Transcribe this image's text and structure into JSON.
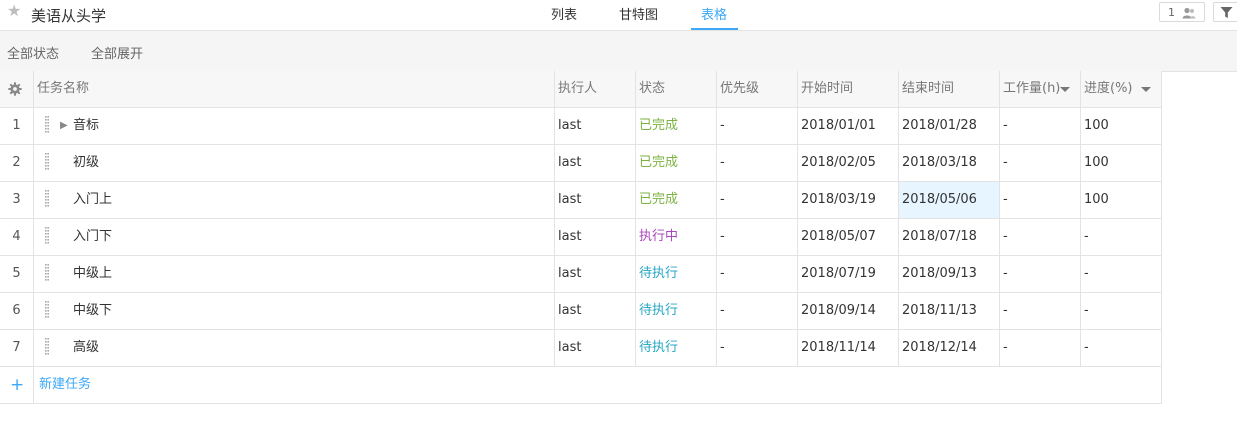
{
  "project": {
    "title": "美语从头学",
    "star_icon": "star-icon"
  },
  "tabs": [
    {
      "label": "列表",
      "active": false
    },
    {
      "label": "甘特图",
      "active": false
    },
    {
      "label": "表格",
      "active": true
    }
  ],
  "header_actions": {
    "member_count": "1",
    "member_icon": "person-icon",
    "filter_icon": "filter-icon"
  },
  "toolbar": {
    "status_all": "全部状态",
    "expand_all": "全部展开"
  },
  "columns": {
    "settings_icon": "gear-icon",
    "name": "任务名称",
    "executor": "执行人",
    "status": "状态",
    "priority": "优先级",
    "start": "开始时间",
    "end": "结束时间",
    "workload": "工作量(h)",
    "progress": "进度(%)"
  },
  "status_colors": {
    "已完成": "#7cb342",
    "执行中": "#ab47bc",
    "待执行": "#26a6c4"
  },
  "rows": [
    {
      "idx": "1",
      "name": "音标",
      "has_children": true,
      "executor": "last",
      "status": "已完成",
      "priority": "-",
      "start": "2018/01/01",
      "end": "2018/01/28",
      "workload": "-",
      "progress": "100"
    },
    {
      "idx": "2",
      "name": "初级",
      "has_children": false,
      "executor": "last",
      "status": "已完成",
      "priority": "-",
      "start": "2018/02/05",
      "end": "2018/03/18",
      "workload": "-",
      "progress": "100"
    },
    {
      "idx": "3",
      "name": "入门上",
      "has_children": false,
      "executor": "last",
      "status": "已完成",
      "priority": "-",
      "start": "2018/03/19",
      "end": "2018/05/06",
      "workload": "-",
      "progress": "100",
      "selected_cell": "end"
    },
    {
      "idx": "4",
      "name": "入门下",
      "has_children": false,
      "executor": "last",
      "status": "执行中",
      "priority": "-",
      "start": "2018/05/07",
      "end": "2018/07/18",
      "workload": "-",
      "progress": "-"
    },
    {
      "idx": "5",
      "name": "中级上",
      "has_children": false,
      "executor": "last",
      "status": "待执行",
      "priority": "-",
      "start": "2018/07/19",
      "end": "2018/09/13",
      "workload": "-",
      "progress": "-"
    },
    {
      "idx": "6",
      "name": "中级下",
      "has_children": false,
      "executor": "last",
      "status": "待执行",
      "priority": "-",
      "start": "2018/09/14",
      "end": "2018/11/13",
      "workload": "-",
      "progress": "-"
    },
    {
      "idx": "7",
      "name": "高级",
      "has_children": false,
      "executor": "last",
      "status": "待执行",
      "priority": "-",
      "start": "2018/11/14",
      "end": "2018/12/14",
      "workload": "-",
      "progress": "-"
    }
  ],
  "new_task": {
    "label": "新建任务",
    "icon": "plus-icon"
  }
}
